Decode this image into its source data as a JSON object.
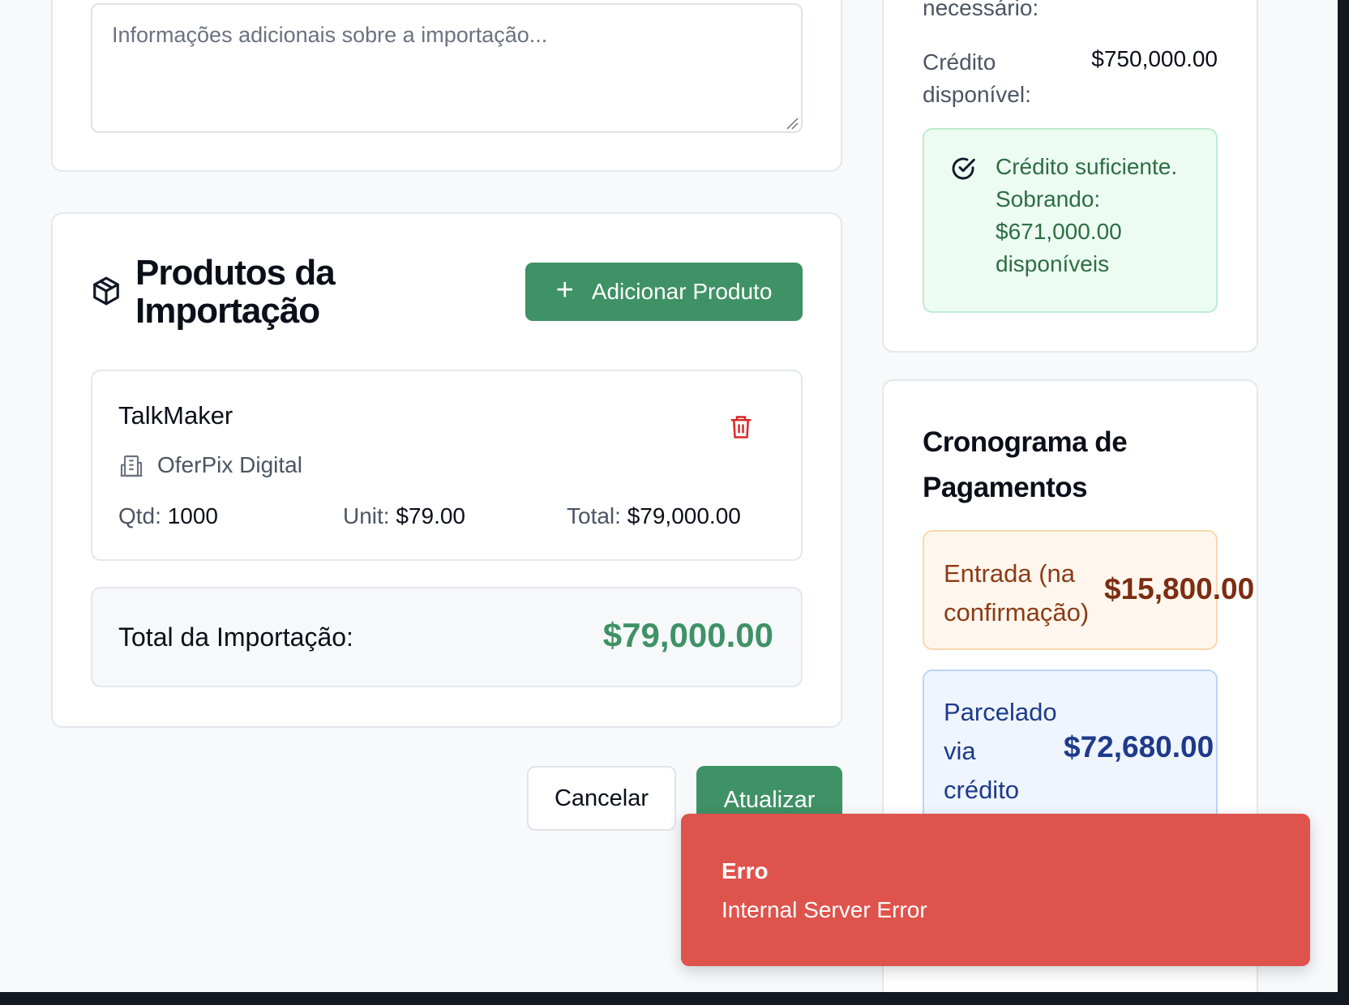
{
  "notes": {
    "placeholder": "Informações adicionais sobre a importação..."
  },
  "products_section": {
    "title": "Produtos da Importação",
    "add_button_label": "Adicionar Produto",
    "items": [
      {
        "name": "TalkMaker",
        "supplier": "OferPix Digital",
        "qty_label": "Qtd:",
        "qty": "1000",
        "unit_label": "Unit:",
        "unit": "$79.00",
        "total_label": "Total:",
        "total": "$79,000.00"
      }
    ],
    "total_label": "Total da Importação:",
    "total_value": "$79,000.00"
  },
  "actions": {
    "cancel_label": "Cancelar",
    "update_label": "Atualizar"
  },
  "credit": {
    "needed_label": "necessário:",
    "available_label": "Crédito disponível:",
    "available_value": "$750,000.00",
    "status_text": "Crédito suficiente. Sobrando: $671,000.00 disponíveis"
  },
  "schedule": {
    "title": "Cronograma de Pagamentos",
    "entry_label": "Entrada (na confirmação)",
    "entry_value": "$15,800.00",
    "credit_label": "Parcelado via crédito",
    "credit_value": "$72,680.00"
  },
  "toast": {
    "title": "Erro",
    "message": "Internal Server Error"
  },
  "colors": {
    "primary_green": "#3f9166",
    "danger": "#df534d",
    "success_bg": "#edfcf2",
    "entry_bg": "#fff7ed",
    "credit_bg": "#eef5ff"
  },
  "icons": [
    "box-icon",
    "plus-icon",
    "building-icon",
    "trash-icon",
    "check-circle-icon"
  ]
}
